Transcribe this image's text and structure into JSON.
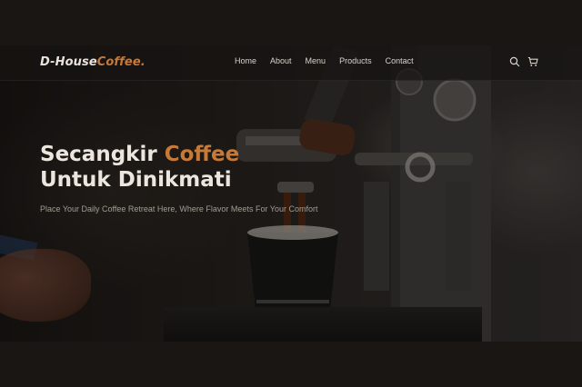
{
  "brand": {
    "name_main": "D-House",
    "name_accent": "Coffee."
  },
  "nav": {
    "items": [
      "Home",
      "About",
      "Menu",
      "Products",
      "Contact"
    ]
  },
  "icons": {
    "search": "search-icon",
    "cart": "cart-icon"
  },
  "hero": {
    "title_line1_prefix": "Secangkir ",
    "title_line1_accent": "Coffee",
    "title_line2": "Untuk Dinikmati",
    "subtitle": "Place Your Daily Coffee Retreat Here, Where Flavor Meets For Your Comfort"
  },
  "colors": {
    "accent": "#c77a38",
    "background": "#1a1613",
    "navbar": "#161412",
    "text": "#ece6de"
  }
}
